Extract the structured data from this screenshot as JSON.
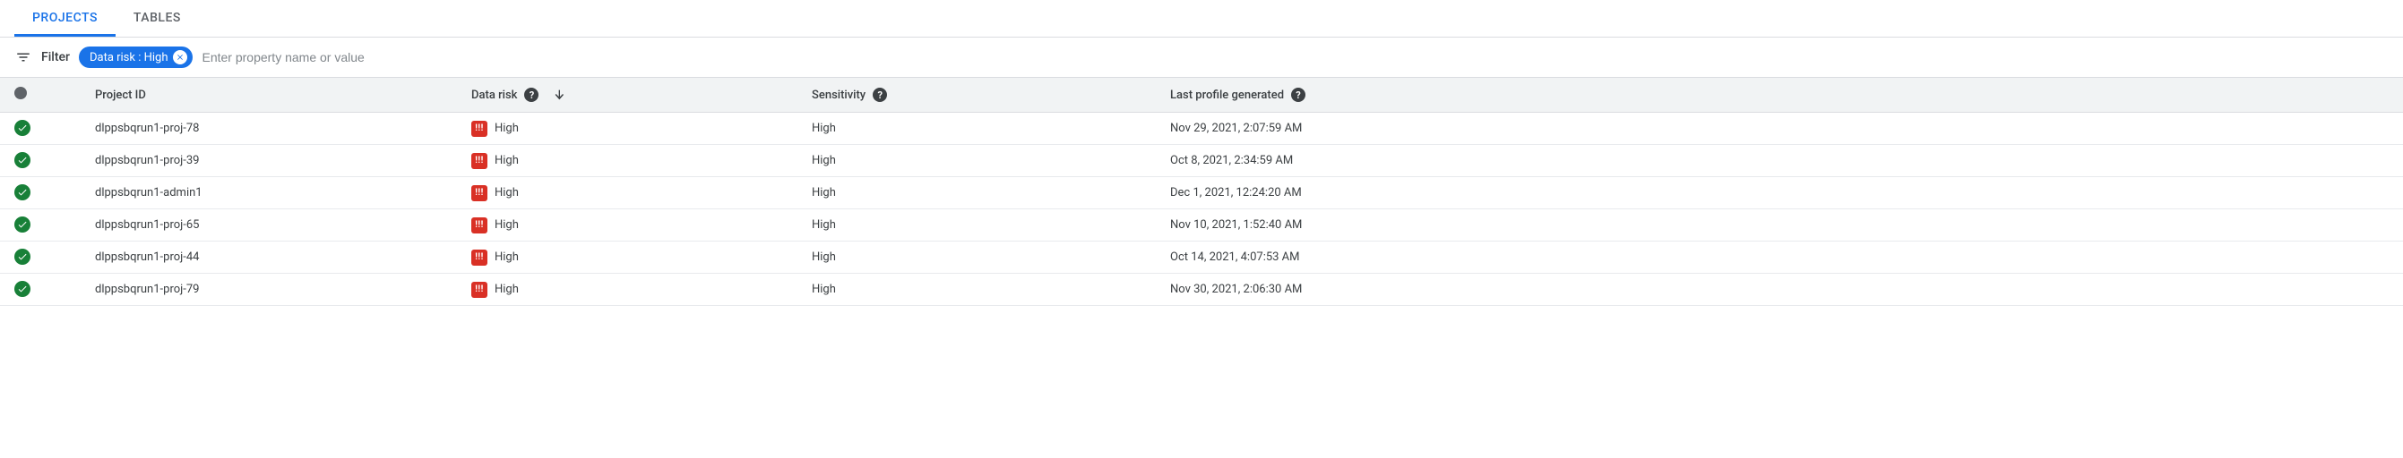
{
  "tabs": {
    "projects": "PROJECTS",
    "tables": "TABLES"
  },
  "filter": {
    "label": "Filter",
    "chip": "Data risk : High",
    "placeholder": "Enter property name or value"
  },
  "columns": {
    "project_id": "Project ID",
    "data_risk": "Data risk",
    "sensitivity": "Sensitivity",
    "last_profile": "Last profile generated"
  },
  "rows": [
    {
      "project_id": "dlppsbqrun1-proj-78",
      "data_risk": "High",
      "sensitivity": "High",
      "last_profile": "Nov 29, 2021, 2:07:59 AM"
    },
    {
      "project_id": "dlppsbqrun1-proj-39",
      "data_risk": "High",
      "sensitivity": "High",
      "last_profile": "Oct 8, 2021, 2:34:59 AM"
    },
    {
      "project_id": "dlppsbqrun1-admin1",
      "data_risk": "High",
      "sensitivity": "High",
      "last_profile": "Dec 1, 2021, 12:24:20 AM"
    },
    {
      "project_id": "dlppsbqrun1-proj-65",
      "data_risk": "High",
      "sensitivity": "High",
      "last_profile": "Nov 10, 2021, 1:52:40 AM"
    },
    {
      "project_id": "dlppsbqrun1-proj-44",
      "data_risk": "High",
      "sensitivity": "High",
      "last_profile": "Oct 14, 2021, 4:07:53 AM"
    },
    {
      "project_id": "dlppsbqrun1-proj-79",
      "data_risk": "High",
      "sensitivity": "High",
      "last_profile": "Nov 30, 2021, 2:06:30 AM"
    }
  ]
}
